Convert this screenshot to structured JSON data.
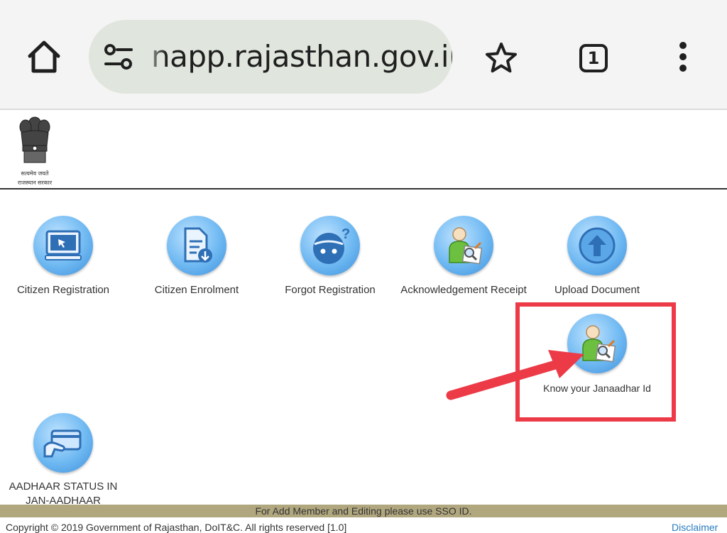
{
  "browser": {
    "url": "napp.rajasthan.gov.in",
    "tab_count": "1",
    "icons": [
      "home-icon",
      "tune-icon",
      "star-icon",
      "tabs-icon",
      "more-vert-icon"
    ]
  },
  "header": {
    "emblem_caption_line1": "सत्यमेव जयते",
    "emblem_caption_line2": "राजस्थान सरकार"
  },
  "menu": {
    "citizen_registration": "Citizen Registration",
    "citizen_enrolment": "Citizen Enrolment",
    "forgot_registration": "Forgot Registration",
    "acknowledgement_receipt": "Acknowledgement Receipt",
    "upload_document": "Upload Document",
    "know_janaadhar": "Know your Janaadhar Id",
    "aadhaar_status_line1": "AADHAAR STATUS IN",
    "aadhaar_status_line2": "JAN-AADHAAR"
  },
  "footer": {
    "notice": "For Add Member and Editing please use SSO ID.",
    "copyright": "Copyright © 2019 Government of Rajasthan, DoIT&C. All rights reserved [1.0]",
    "disclaimer": "Disclaimer"
  },
  "colors": {
    "highlight": "#ec3a47",
    "footer_bar": "#b1a77f",
    "icon_blue": "#4a9be0"
  }
}
